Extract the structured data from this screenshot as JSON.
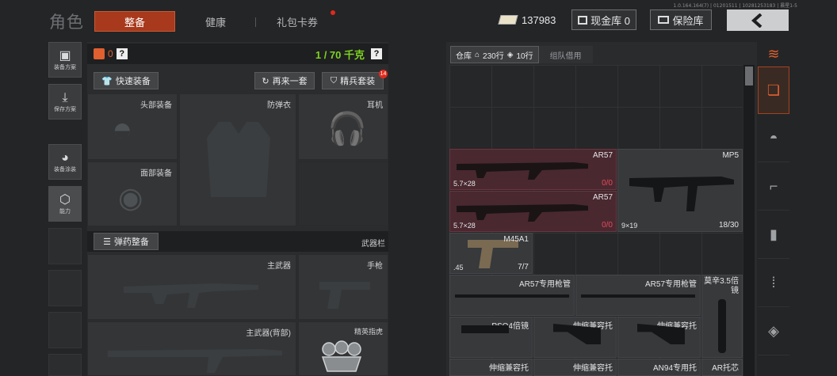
{
  "version_text": "1.0.164.164(7) | 01201511 | 10281253183 | 晨星1-5",
  "header": {
    "title": "角色",
    "tabs": [
      {
        "label": "整备"
      },
      {
        "label": "健康"
      },
      {
        "label": "礼包卡券"
      }
    ],
    "money": "137983",
    "cash_vault": "现金库 0",
    "safe_box": "保险库"
  },
  "left_nav": [
    {
      "label": "装备方案",
      "icon": "backpack-icon"
    },
    {
      "label": "保存方案",
      "icon": "download-icon"
    },
    {
      "label": "装备涂装",
      "icon": "helmet-paint-icon"
    },
    {
      "label": "能力",
      "icon": "ability-icon"
    }
  ],
  "loadout": {
    "armor_value": "0",
    "weight": "1 / 70 千克",
    "quick_equip": "快速装备",
    "again_set": "再来一套",
    "elite_set": "精兵套装",
    "elite_badge": "14",
    "slots": {
      "head": "头部装备",
      "armor": "防弹衣",
      "headset": "耳机",
      "face": "面部装备",
      "main": "主武器",
      "pistol": "手枪",
      "main_back": "主武器(背部)",
      "knuckle": "精英指虎"
    },
    "ammo_equip": "弹药整备",
    "weapon_bar": "武器栏"
  },
  "warehouse": {
    "tab_storage": "仓库",
    "rows_total": "230行",
    "rows_free": "10行",
    "tab_team": "组队借用",
    "items": [
      {
        "name": "AR57",
        "ammo": "5.7×28",
        "count": "0/0"
      },
      {
        "name": "AR57",
        "ammo": "5.7×28",
        "count": "0/0"
      },
      {
        "name": "MP5",
        "ammo": "9×19",
        "count": "18/30"
      },
      {
        "name": "M45A1",
        "ammo": ".45",
        "count": "7/7"
      },
      {
        "name": "AR57专用枪管"
      },
      {
        "name": "AR57专用枪管"
      },
      {
        "name": "莫辛3.5倍镜"
      },
      {
        "name": "PSO4倍镜"
      },
      {
        "name": "伸缩兼容托"
      },
      {
        "name": "伸缩兼容托"
      },
      {
        "name": "伸缩兼容托"
      },
      {
        "name": "伸缩兼容托"
      },
      {
        "name": "AN94专用托"
      },
      {
        "name": "AR托芯"
      }
    ]
  },
  "colors": {
    "accent": "#a8391c",
    "danger": "#e04b5a",
    "weight_green": "#7ed321"
  }
}
